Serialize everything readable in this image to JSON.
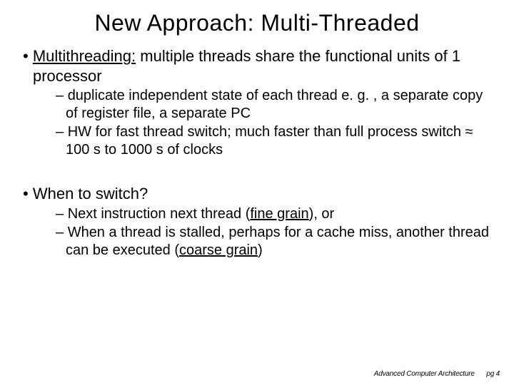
{
  "title": "New Approach: Multi-Threaded",
  "b1": {
    "lead": "Multithreading:",
    "rest": " multiple threads share the functional units of 1 processor",
    "sub1": "duplicate independent state of each thread e. g. , a separate copy of register file, a separate PC",
    "sub2": "HW for fast thread switch; much faster than full process switch ≈ 100 s to 1000 s of clocks"
  },
  "b2": {
    "text": "When to switch?",
    "sub1_a": "Next instruction next thread (",
    "sub1_u": "fine grain",
    "sub1_b": "), or",
    "sub2_a": "When a thread is stalled, perhaps for a cache miss, another thread can be executed (",
    "sub2_u": "coarse grain",
    "sub2_b": ")"
  },
  "footer": {
    "course": "Advanced Computer Architecture",
    "page": "pg 4"
  }
}
